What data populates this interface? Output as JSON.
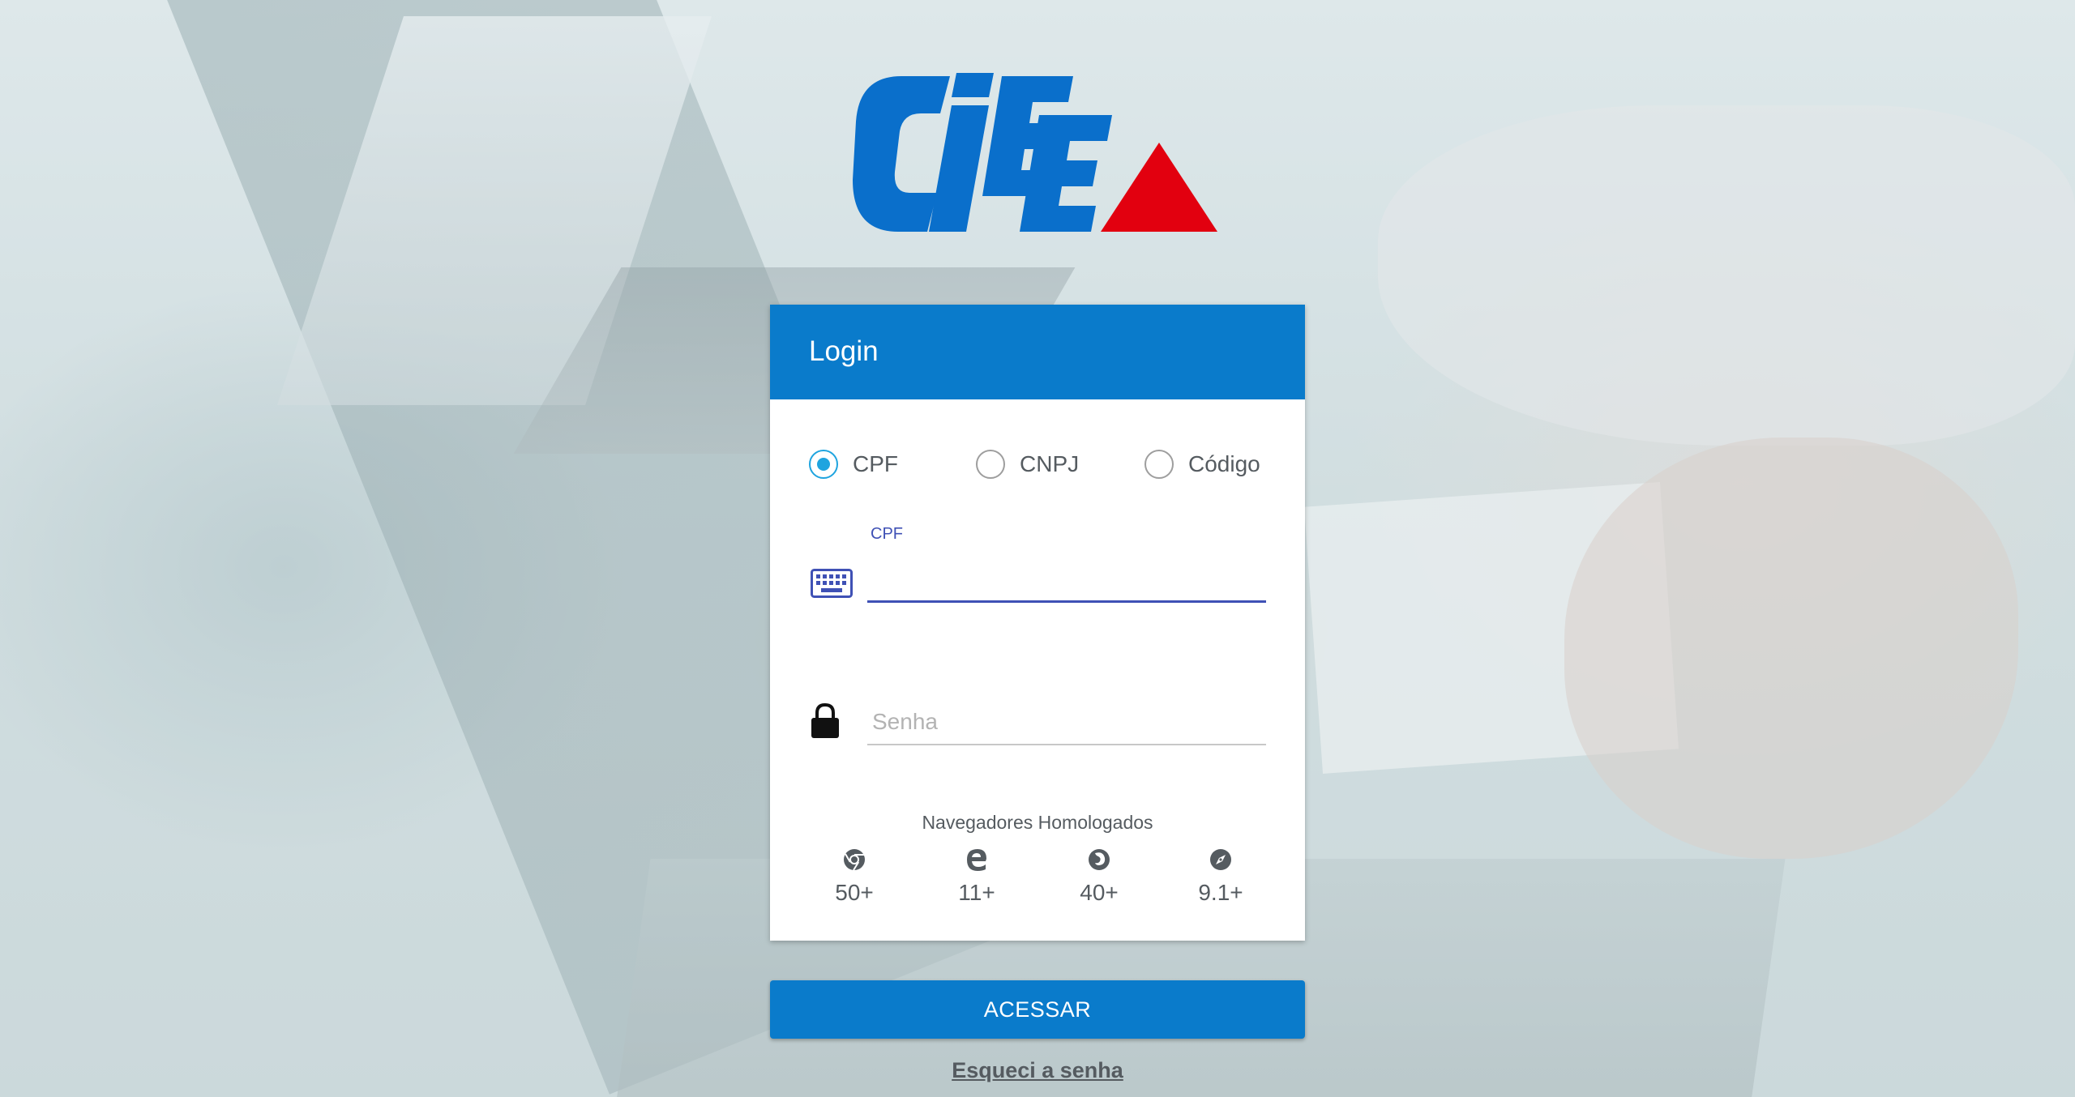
{
  "brand": {
    "logo_text": "CIEE",
    "logo_blue": "#0a6fcb",
    "logo_red": "#e2000f"
  },
  "colors": {
    "primary": "#0a7bcb",
    "radio_accent": "#1fa4df",
    "input_focus": "#3f51b5"
  },
  "login": {
    "title": "Login",
    "login_types": [
      {
        "label": "CPF",
        "selected": true
      },
      {
        "label": "CNPJ",
        "selected": false
      },
      {
        "label": "Código",
        "selected": false
      }
    ],
    "cpf_field": {
      "label": "CPF",
      "value": "",
      "icon": "keyboard-icon"
    },
    "password_field": {
      "placeholder": "Senha",
      "value": "",
      "icon": "lock-icon"
    },
    "browsers": {
      "title": "Navegadores Homologados",
      "items": [
        {
          "icon": "chrome-icon",
          "version": "50+"
        },
        {
          "icon": "edge-icon",
          "version": "11+"
        },
        {
          "icon": "firefox-icon",
          "version": "40+"
        },
        {
          "icon": "safari-icon",
          "version": "9.1+"
        }
      ]
    }
  },
  "actions": {
    "submit_label": "ACESSAR",
    "forgot_password_label": "Esqueci a senha"
  }
}
